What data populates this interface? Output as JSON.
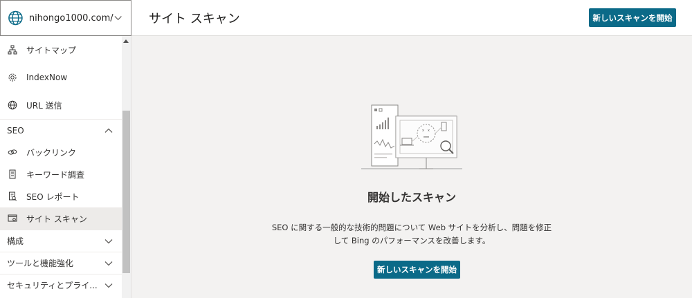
{
  "site_selector": {
    "value": "nihongo1000.com/",
    "icon": "globe-icon"
  },
  "header": {
    "title": "サイト スキャン",
    "primary_button": "新しいスキャンを開始"
  },
  "sidebar": {
    "items": [
      {
        "label": "サイトマップ",
        "icon": "sitemap-icon"
      },
      {
        "label": "IndexNow",
        "icon": "gear-icon"
      },
      {
        "label": "URL 送信",
        "icon": "globe-icon"
      }
    ],
    "seo_section": {
      "label": "SEO",
      "expanded": true,
      "items": [
        {
          "label": "バックリンク",
          "icon": "link-icon"
        },
        {
          "label": "キーワード調査",
          "icon": "document-icon"
        },
        {
          "label": "SEO レポート",
          "icon": "report-icon"
        },
        {
          "label": "サイト スキャン",
          "icon": "scan-icon",
          "selected": true
        }
      ]
    },
    "collapsed_sections": [
      {
        "label": "構成"
      },
      {
        "label": "ツールと機能強化"
      },
      {
        "label": "セキュリティとプライ..."
      }
    ]
  },
  "empty_state": {
    "title": "開始したスキャン",
    "description": "SEO に関する一般的な技術的問題について Web サイトを分析し、問題を修正して Bing のパフォーマンスを改善します。",
    "button": "新しいスキャンを開始"
  },
  "colors": {
    "accent": "#0b6a88",
    "selected_bg": "#edebe9",
    "content_bg": "#f3f2f1"
  }
}
